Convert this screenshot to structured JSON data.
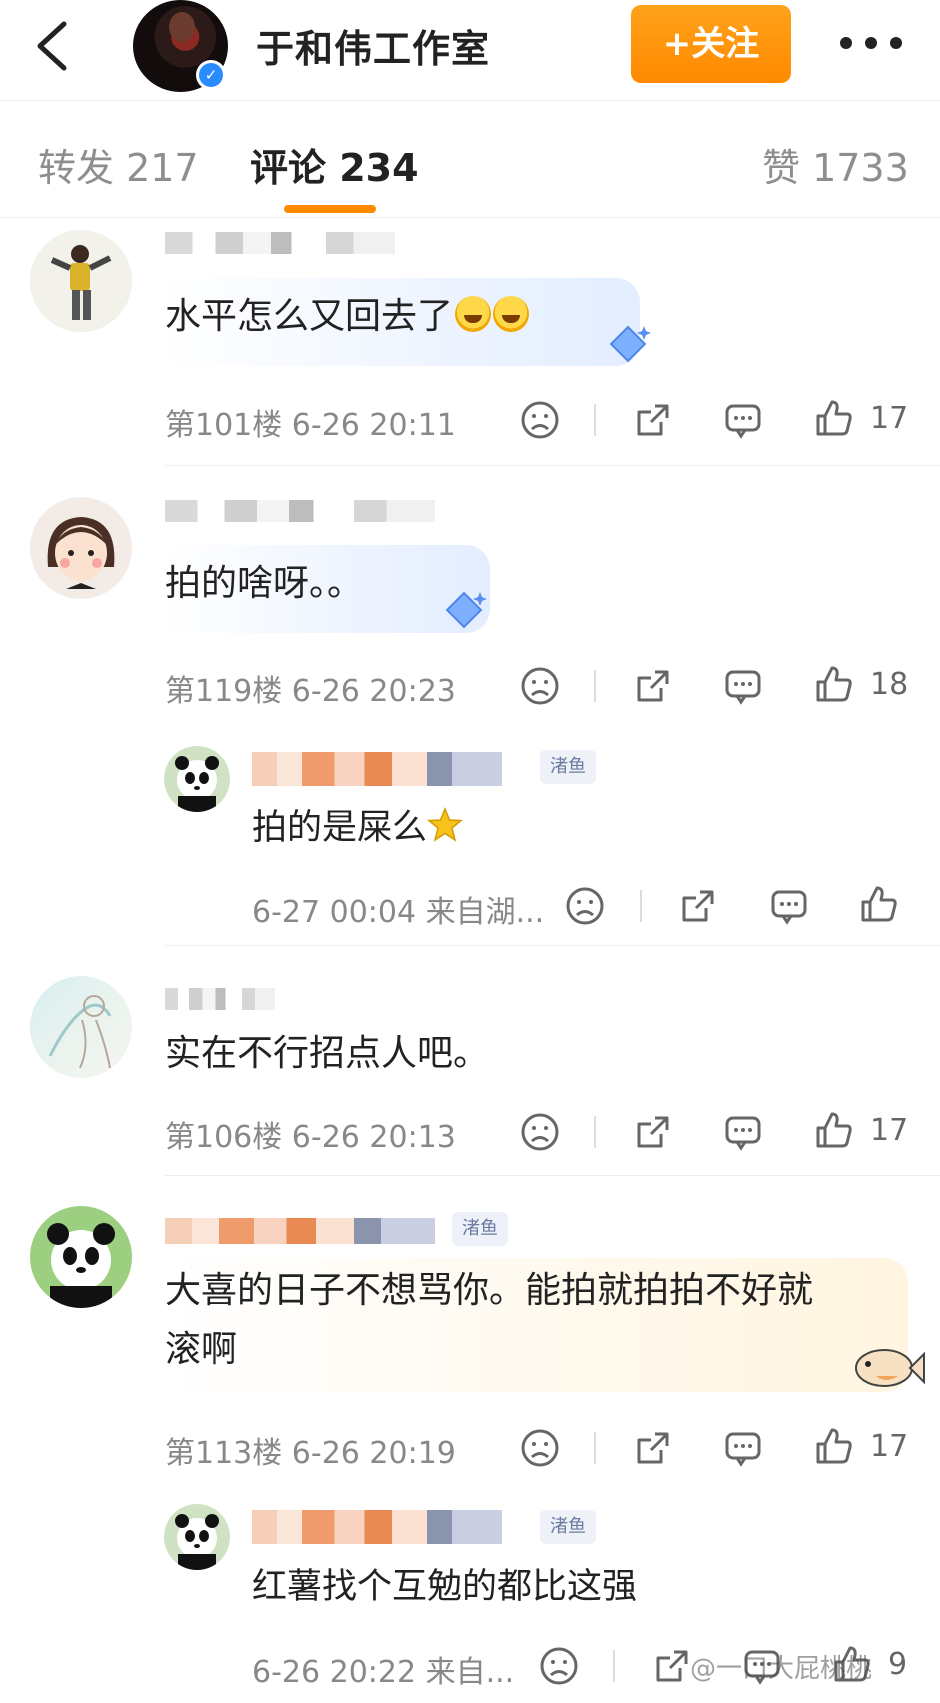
{
  "header": {
    "title": "于和伟工作室",
    "follow_label": "+关注"
  },
  "tabs": [
    {
      "label": "转发 217"
    },
    {
      "label": "评论 234"
    },
    {
      "label": "赞 1733"
    }
  ],
  "comments": [
    {
      "text": "水平怎么又回去了",
      "floor_time": "第101楼 6-26 20:11",
      "likes": "17"
    },
    {
      "text": "拍的啥呀。。",
      "floor_time": "第119楼 6-26 20:23",
      "likes": "18",
      "reply": {
        "tag": "渚鱼",
        "text": "拍的是屎么",
        "time_loc": "6-27 00:04  来自湖..."
      }
    },
    {
      "text": "实在不行招点人吧。",
      "floor_time": "第106楼 6-26 20:13",
      "likes": "17"
    },
    {
      "tag": "渚鱼",
      "text_line1": "大喜的日子不想骂你。能拍就拍拍不好就",
      "text_line2": "滚啊",
      "floor_time": "第113楼 6-26 20:19",
      "likes": "17",
      "reply": {
        "tag": "渚鱼",
        "text": "红薯找个互勉的都比这强",
        "time_loc": "6-26 20:22  来自...",
        "likes": "9"
      }
    }
  ],
  "watermark": "@一口大屁桃桃"
}
